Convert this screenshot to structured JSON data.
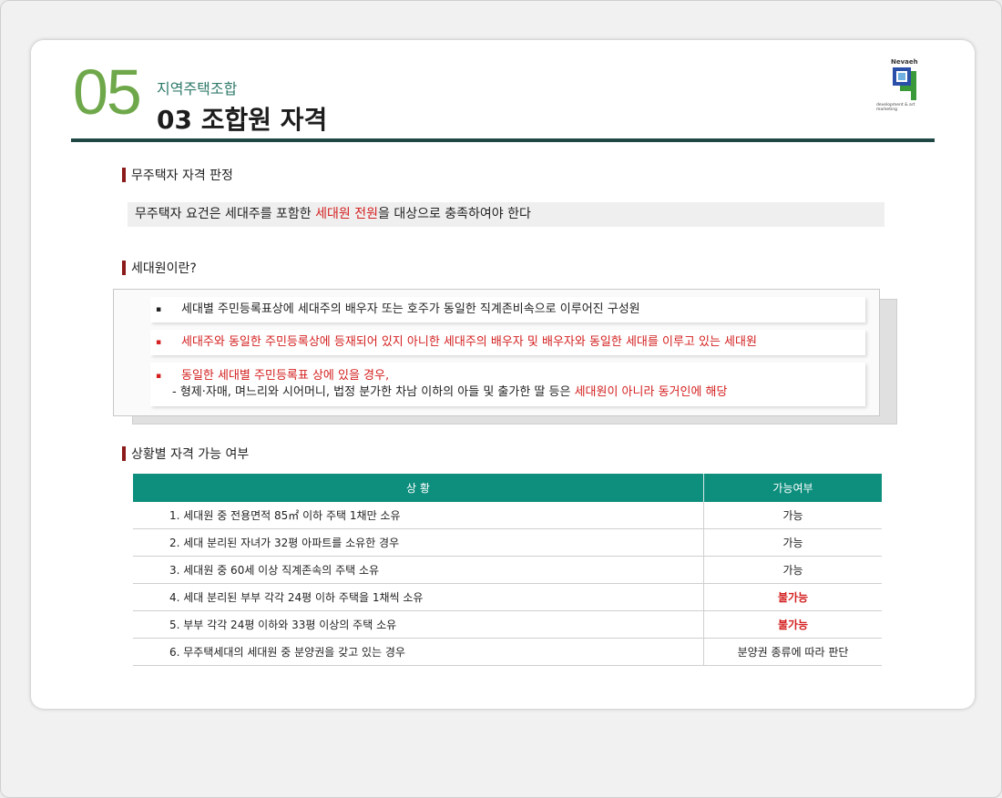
{
  "header": {
    "number": "05",
    "subtitle": "지역주택조합",
    "title": "03 조합원 자격"
  },
  "logo": {
    "brand": "Nevaeh",
    "tagline": "development & art marketing",
    "colors": {
      "green": "#3a9a3a",
      "blue": "#2a4fa8"
    }
  },
  "section1": {
    "heading": "무주택자 자격 판정",
    "statement_pre": "무주택자 요건은 세대주를 포함한 ",
    "statement_highlight": "세대원 전원",
    "statement_post": "을 대상으로 충족하여야 한다"
  },
  "section2": {
    "heading": "세대원이란?",
    "items": [
      {
        "bullet": "▪",
        "text": "세대별 주민등록표상에 세대주의 배우자 또는 호주가 동일한 직계존비속으로 이루어진 구성원"
      },
      {
        "bullet": "▪",
        "text": "세대주와 동일한 주민등록상에 등재되어 있지 아니한 세대주의 배우자 및 배우자와 동일한 세대를 이루고 있는 세대원"
      },
      {
        "bullet": "▪",
        "text": "동일한 세대별 주민등록표 상에 있을 경우,",
        "sub_pre": "- 형제·자매, 며느리와 시어머니, 법정 분가한 차남 이하의 아들 및 출가한 딸 등은 ",
        "sub_highlight": "세대원이 아니라 동거인에 해당"
      }
    ]
  },
  "section3": {
    "heading": "상황별 자격 가능 여부",
    "columns": [
      "상 황",
      "가능여부"
    ],
    "rows": [
      {
        "situation": "1. 세대원 중 전용면적 85㎡ 이하 주택 1채만 소유",
        "result": "가능",
        "ok": true
      },
      {
        "situation": "2. 세대 분리된 자녀가 32평 아파트를 소유한 경우",
        "result": "가능",
        "ok": true
      },
      {
        "situation": "3. 세대원 중 60세 이상 직계존속의 주택 소유",
        "result": "가능",
        "ok": true
      },
      {
        "situation": "4. 세대 분리된 부부 각각 24평 이하 주택을 1채씩 소유",
        "result": "불가능",
        "ok": false
      },
      {
        "situation": "5. 부부 각각 24평 이하와 33평 이상의 주택 소유",
        "result": "불가능",
        "ok": false
      },
      {
        "situation": "6. 무주택세대의 세대원 중 분양권을 갖고 있는 경우",
        "result": "분양권 종류에 따라 판단",
        "ok": true
      }
    ]
  },
  "colors": {
    "accent_green": "#6fa84a",
    "table_header": "#0e8f7e",
    "highlight_red": "#d42020",
    "rule": "#1f4743"
  }
}
